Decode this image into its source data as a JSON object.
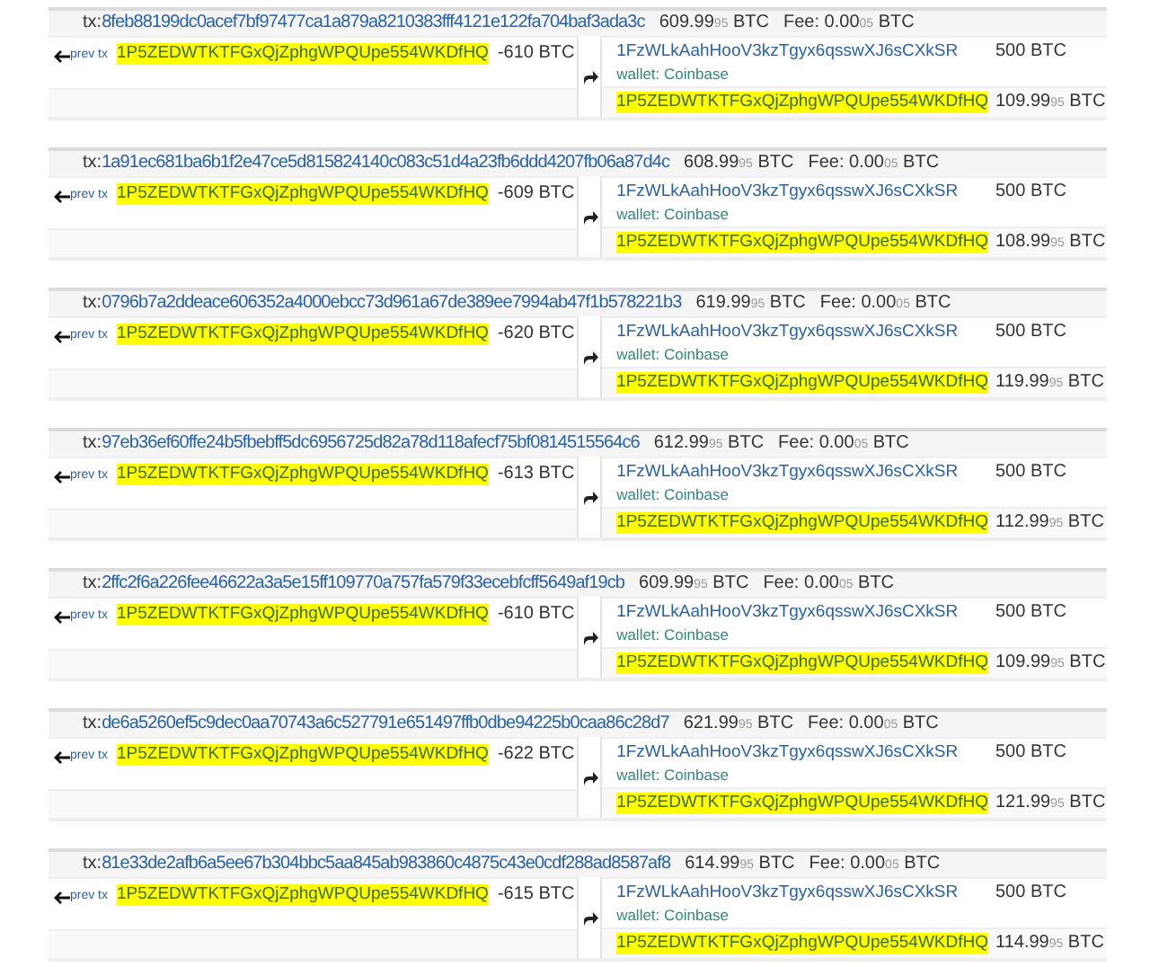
{
  "transactions": [
    {
      "label": "tx:",
      "hash": "8feb88199dc0acef7bf97477ca1a879a8210383fff4121e122fa704baf3ada3c",
      "total": "609.99$_{95}$ BTC",
      "fee": "Fee: 0.00$_{05}$ BTC",
      "prev": "prev tx",
      "input": {
        "address": "1P5ZEDWTKTFGxQjZphgWPQUpe554WKDfHQ",
        "amount": "-610 BTC",
        "highlighted": true
      },
      "outputs": [
        {
          "address": "1FzWLkAahHooV3kzTgyx6qsswXJ6sCXkSR",
          "wallet": "wallet: Coinbase",
          "amount": "500 BTC",
          "highlighted": false
        },
        {
          "address": "1P5ZEDWTKTFGxQjZphgWPQUpe554WKDfHQ",
          "amount": "109.99$_{95}$ BTC",
          "highlighted": true
        }
      ]
    },
    {
      "label": "tx:",
      "hash": "1a91ec681ba6b1f2e47ce5d815824140c083c51d4a23fb6ddd4207fb06a87d4c",
      "total": "608.99$_{95}$ BTC",
      "fee": "Fee: 0.00$_{05}$ BTC",
      "prev": "prev tx",
      "input": {
        "address": "1P5ZEDWTKTFGxQjZphgWPQUpe554WKDfHQ",
        "amount": "-609 BTC",
        "highlighted": true
      },
      "outputs": [
        {
          "address": "1FzWLkAahHooV3kzTgyx6qsswXJ6sCXkSR",
          "wallet": "wallet: Coinbase",
          "amount": "500 BTC",
          "highlighted": false
        },
        {
          "address": "1P5ZEDWTKTFGxQjZphgWPQUpe554WKDfHQ",
          "amount": "108.99$_{95}$ BTC",
          "highlighted": true
        }
      ]
    },
    {
      "label": "tx:",
      "hash": "0796b7a2ddeace606352a4000ebcc73d961a67de389ee7994ab47f1b578221b3",
      "total": "619.99$_{95}$ BTC",
      "fee": "Fee: 0.00$_{05}$ BTC",
      "prev": "prev tx",
      "input": {
        "address": "1P5ZEDWTKTFGxQjZphgWPQUpe554WKDfHQ",
        "amount": "-620 BTC",
        "highlighted": true
      },
      "outputs": [
        {
          "address": "1FzWLkAahHooV3kzTgyx6qsswXJ6sCXkSR",
          "wallet": "wallet: Coinbase",
          "amount": "500 BTC",
          "highlighted": false
        },
        {
          "address": "1P5ZEDWTKTFGxQjZphgWPQUpe554WKDfHQ",
          "amount": "119.99$_{95}$ BTC",
          "highlighted": true
        }
      ]
    },
    {
      "label": "tx:",
      "hash": "97eb36ef60ffe24b5fbebff5dc6956725d82a78d118afecf75bf0814515564c6",
      "total": "612.99$_{95}$ BTC",
      "fee": "Fee: 0.00$_{05}$ BTC",
      "prev": "prev tx",
      "input": {
        "address": "1P5ZEDWTKTFGxQjZphgWPQUpe554WKDfHQ",
        "amount": "-613 BTC",
        "highlighted": true
      },
      "outputs": [
        {
          "address": "1FzWLkAahHooV3kzTgyx6qsswXJ6sCXkSR",
          "wallet": "wallet: Coinbase",
          "amount": "500 BTC",
          "highlighted": false
        },
        {
          "address": "1P5ZEDWTKTFGxQjZphgWPQUpe554WKDfHQ",
          "amount": "112.99$_{95}$ BTC",
          "highlighted": true
        }
      ]
    },
    {
      "label": "tx:",
      "hash": "2ffc2f6a226fee46622a3a5e15ff109770a757fa579f33ecebfcff5649af19cb",
      "total": "609.99$_{95}$ BTC",
      "fee": "Fee: 0.00$_{05}$ BTC",
      "prev": "prev tx",
      "input": {
        "address": "1P5ZEDWTKTFGxQjZphgWPQUpe554WKDfHQ",
        "amount": "-610 BTC",
        "highlighted": true
      },
      "outputs": [
        {
          "address": "1FzWLkAahHooV3kzTgyx6qsswXJ6sCXkSR",
          "wallet": "wallet: Coinbase",
          "amount": "500 BTC",
          "highlighted": false
        },
        {
          "address": "1P5ZEDWTKTFGxQjZphgWPQUpe554WKDfHQ",
          "amount": "109.99$_{95}$ BTC",
          "highlighted": true
        }
      ]
    },
    {
      "label": "tx:",
      "hash": "de6a5260ef5c9dec0aa70743a6c527791e651497ffb0dbe94225b0caa86c28d7",
      "total": "621.99$_{95}$ BTC",
      "fee": "Fee: 0.00$_{05}$ BTC",
      "prev": "prev tx",
      "input": {
        "address": "1P5ZEDWTKTFGxQjZphgWPQUpe554WKDfHQ",
        "amount": "-622 BTC",
        "highlighted": true
      },
      "outputs": [
        {
          "address": "1FzWLkAahHooV3kzTgyx6qsswXJ6sCXkSR",
          "wallet": "wallet: Coinbase",
          "amount": "500 BTC",
          "highlighted": false
        },
        {
          "address": "1P5ZEDWTKTFGxQjZphgWPQUpe554WKDfHQ",
          "amount": "121.99$_{95}$ BTC",
          "highlighted": true
        }
      ]
    },
    {
      "label": "tx:",
      "hash": "81e33de2afb6a5ee67b304bbc5aa845ab983860c4875c43e0cdf288ad8587af8",
      "total": "614.99$_{95}$ BTC",
      "fee": "Fee: 0.00$_{05}$ BTC",
      "prev": "prev tx",
      "input": {
        "address": "1P5ZEDWTKTFGxQjZphgWPQUpe554WKDfHQ",
        "amount": "-615 BTC",
        "highlighted": true
      },
      "outputs": [
        {
          "address": "1FzWLkAahHooV3kzTgyx6qsswXJ6sCXkSR",
          "wallet": "wallet: Coinbase",
          "amount": "500 BTC",
          "highlighted": false
        },
        {
          "address": "1P5ZEDWTKTFGxQjZphgWPQUpe554WKDfHQ",
          "amount": "114.99$_{95}$ BTC",
          "highlighted": true
        }
      ]
    }
  ]
}
